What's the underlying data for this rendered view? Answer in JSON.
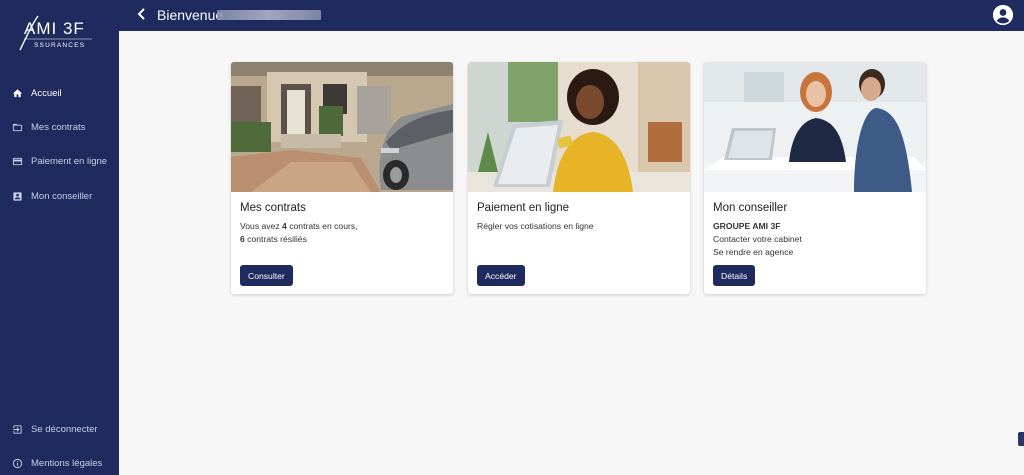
{
  "brand": {
    "logo_text": "AMI 3F",
    "logo_sub": "ASSURANCES"
  },
  "colors": {
    "primary": "#1f2a5e",
    "sidebar_text": "#c9cfe6",
    "background": "#f7f7f8"
  },
  "header": {
    "greeting": "Bienvenue",
    "back_icon": "chevron-left-icon",
    "account_icon": "account-circle-icon"
  },
  "sidebar": {
    "items": [
      {
        "label": "Accueil",
        "icon": "home-icon",
        "active": true
      },
      {
        "label": "Mes contrats",
        "icon": "folder-icon",
        "active": false
      },
      {
        "label": "Paiement en ligne",
        "icon": "credit-card-icon",
        "active": false
      },
      {
        "label": "Mon conseiller",
        "icon": "contact-card-icon",
        "active": false
      }
    ],
    "bottom": [
      {
        "label": "Se déconnecter",
        "icon": "logout-icon"
      },
      {
        "label": "Mentions légales",
        "icon": "info-icon"
      }
    ]
  },
  "cards": [
    {
      "title": "Mes contrats",
      "text_prefix": "Vous avez ",
      "active_count": "4",
      "text_middle": " contrats en cours,",
      "closed_count": "6",
      "text_suffix": " contrats résiliés",
      "button": "Consulter"
    },
    {
      "title": "Paiement en ligne",
      "text": "Régler vos cotisations en ligne",
      "button": "Accéder"
    },
    {
      "title": "Mon conseiller",
      "org": "GROUPE AMI 3F",
      "line1": "Contacter votre cabinet",
      "line2": "Se rendre en agence",
      "button": "Détails"
    }
  ]
}
